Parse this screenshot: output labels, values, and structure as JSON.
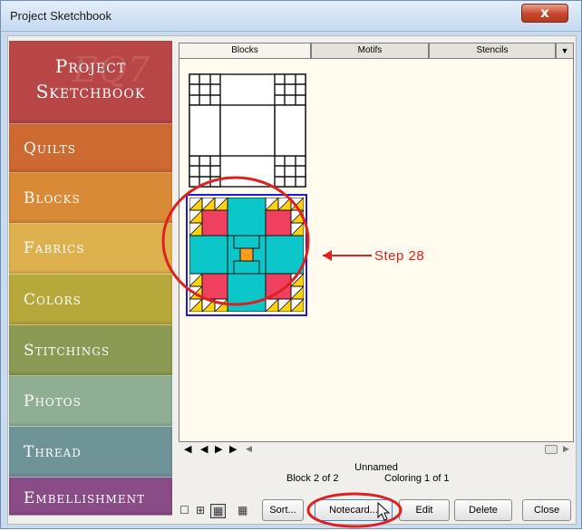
{
  "window": {
    "title": "Project Sketchbook",
    "close_glyph": "x"
  },
  "sidebar": {
    "header_line1": "Project",
    "header_line2": "Sketchbook",
    "watermark": "EQ7",
    "items": [
      {
        "label": "Quilts",
        "color": "#cd6a31"
      },
      {
        "label": "Blocks",
        "color": "#d98a37"
      },
      {
        "label": "Fabrics",
        "color": "#ddb24e"
      },
      {
        "label": "Colors",
        "color": "#b6a83a"
      },
      {
        "label": "Stitchings",
        "color": "#8b9a52"
      },
      {
        "label": "Photos",
        "color": "#8fae94"
      },
      {
        "label": "Thread",
        "color": "#6f9498"
      },
      {
        "label": "Embellishment",
        "color": "#8a4c86"
      }
    ]
  },
  "tabs": [
    {
      "label": "Blocks",
      "active": true
    },
    {
      "label": "Motifs",
      "active": false
    },
    {
      "label": "Stencils",
      "active": false
    }
  ],
  "annotation": {
    "label": "Step 28",
    "color": "#e02020"
  },
  "block_colors": {
    "pink": "#f0405f",
    "teal": "#0bc7c9",
    "orange": "#ff9a1c",
    "yellow": "#ffd30a",
    "selection": "#1a1ae0"
  },
  "status": {
    "name": "Unnamed",
    "block": "Block 2 of 2",
    "coloring": "Coloring 1 of 1"
  },
  "buttons": {
    "sort": "Sort...",
    "notecard": "Notecard...",
    "edit": "Edit",
    "delete": "Delete",
    "close": "Close"
  },
  "view_icons": [
    "view-1x1-icon",
    "view-2x2-icon",
    "view-3x3-icon",
    "view-4x4-icon"
  ]
}
